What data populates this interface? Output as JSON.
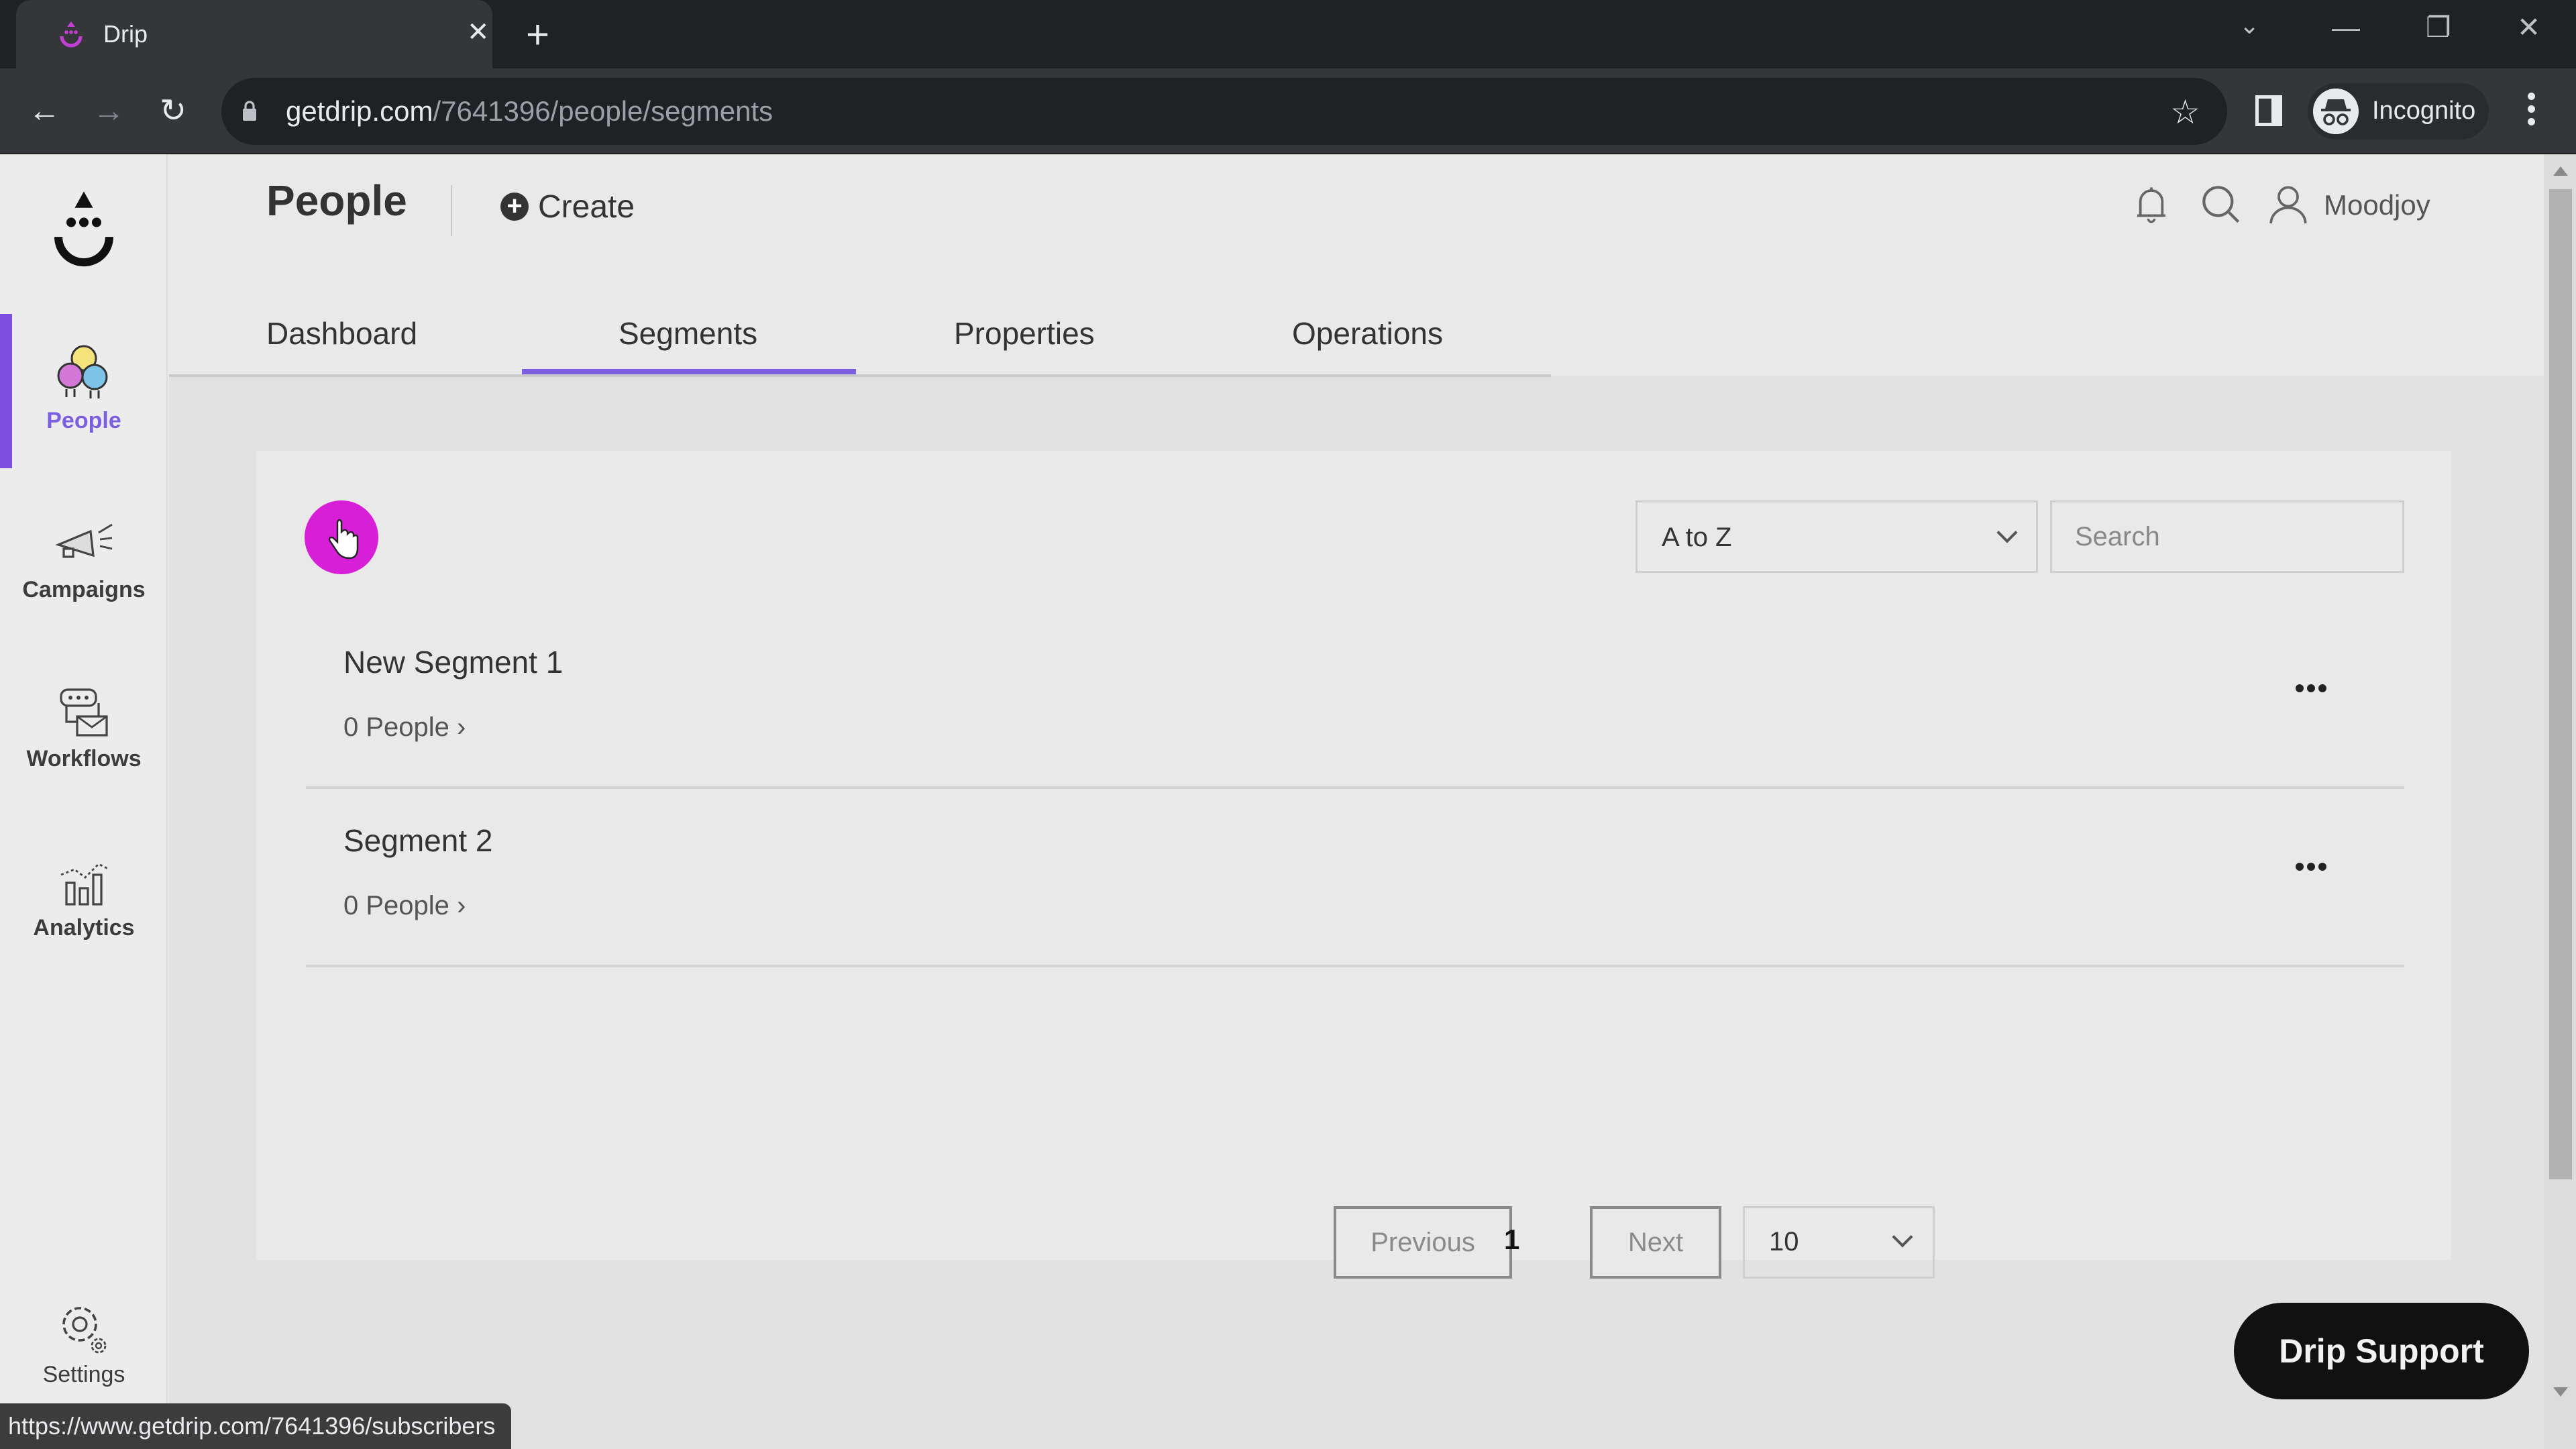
{
  "browser": {
    "tab_title": "Drip",
    "url_host": "getdrip.com",
    "url_path": "/7641396/people/segments",
    "profile_label": "Incognito",
    "status_url": "https://www.getdrip.com/7641396/subscribers"
  },
  "sidebar": {
    "items": [
      {
        "label": "People",
        "icon": "people-icon",
        "active": true
      },
      {
        "label": "Campaigns",
        "icon": "megaphone-icon"
      },
      {
        "label": "Workflows",
        "icon": "workflow-icon"
      },
      {
        "label": "Analytics",
        "icon": "analytics-icon"
      },
      {
        "label": "Settings",
        "icon": "gear-icon"
      }
    ]
  },
  "header": {
    "title": "People",
    "create_label": "Create",
    "user_name": "Moodjoy"
  },
  "tabs": [
    {
      "label": "Dashboard"
    },
    {
      "label": "Segments",
      "active": true
    },
    {
      "label": "Properties"
    },
    {
      "label": "Operations"
    }
  ],
  "controls": {
    "sort_value": "A to Z",
    "search_placeholder": "Search",
    "search_value": ""
  },
  "segments": [
    {
      "name": "New Segment 1",
      "count": "0 People ›"
    },
    {
      "name": "Segment 2",
      "count": "0 People ›"
    }
  ],
  "pagination": {
    "previous_label": "Previous",
    "current_page": "1",
    "next_label": "Next",
    "per_page": "10"
  },
  "support": {
    "label": "Drip Support"
  },
  "colors": {
    "accent": "#7c5ee0",
    "cursor_highlight": "#d61fd6",
    "support_bg": "#111111"
  }
}
